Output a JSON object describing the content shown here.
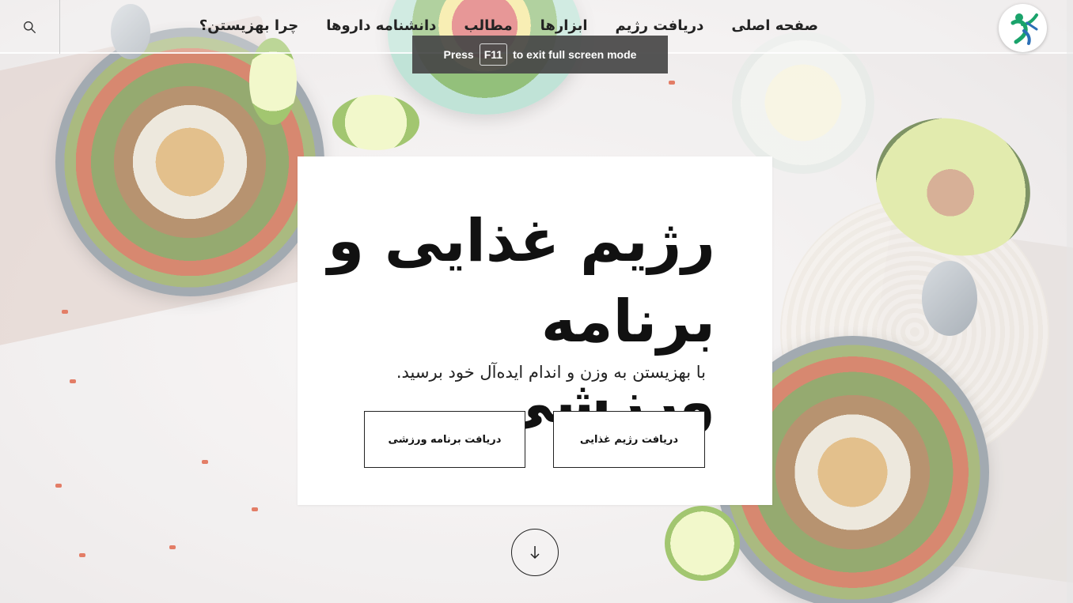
{
  "header": {
    "nav_items": [
      {
        "label": "صفحه اصلی"
      },
      {
        "label": "دریافت رژیم"
      },
      {
        "label": "ابزارها"
      },
      {
        "label": "مطالب"
      },
      {
        "label": "دانشنامه داروها"
      },
      {
        "label": "چرا بهزیستن؟"
      }
    ],
    "search_icon": "search-icon",
    "logo_icon": "figure-logo-icon"
  },
  "fullscreen_notice": {
    "prefix": "Press",
    "key": "F11",
    "suffix": "to exit full screen mode"
  },
  "hero": {
    "title_line1": "رژیم غذایی و",
    "title_line2": "برنامه ورزشی",
    "subtitle": "با بهزیستن به وزن و اندام ایده‌آل خود برسید.",
    "diet_button": "دریافت رژیم غذایی",
    "workout_button": "دریافت برنامه ورزشی"
  },
  "scroll_icon": "arrow-down-icon",
  "colors": {
    "text": "#222222",
    "logo_green": "#1aa36b",
    "logo_blue": "#2b6fb6",
    "toast_bg": "#464646"
  }
}
